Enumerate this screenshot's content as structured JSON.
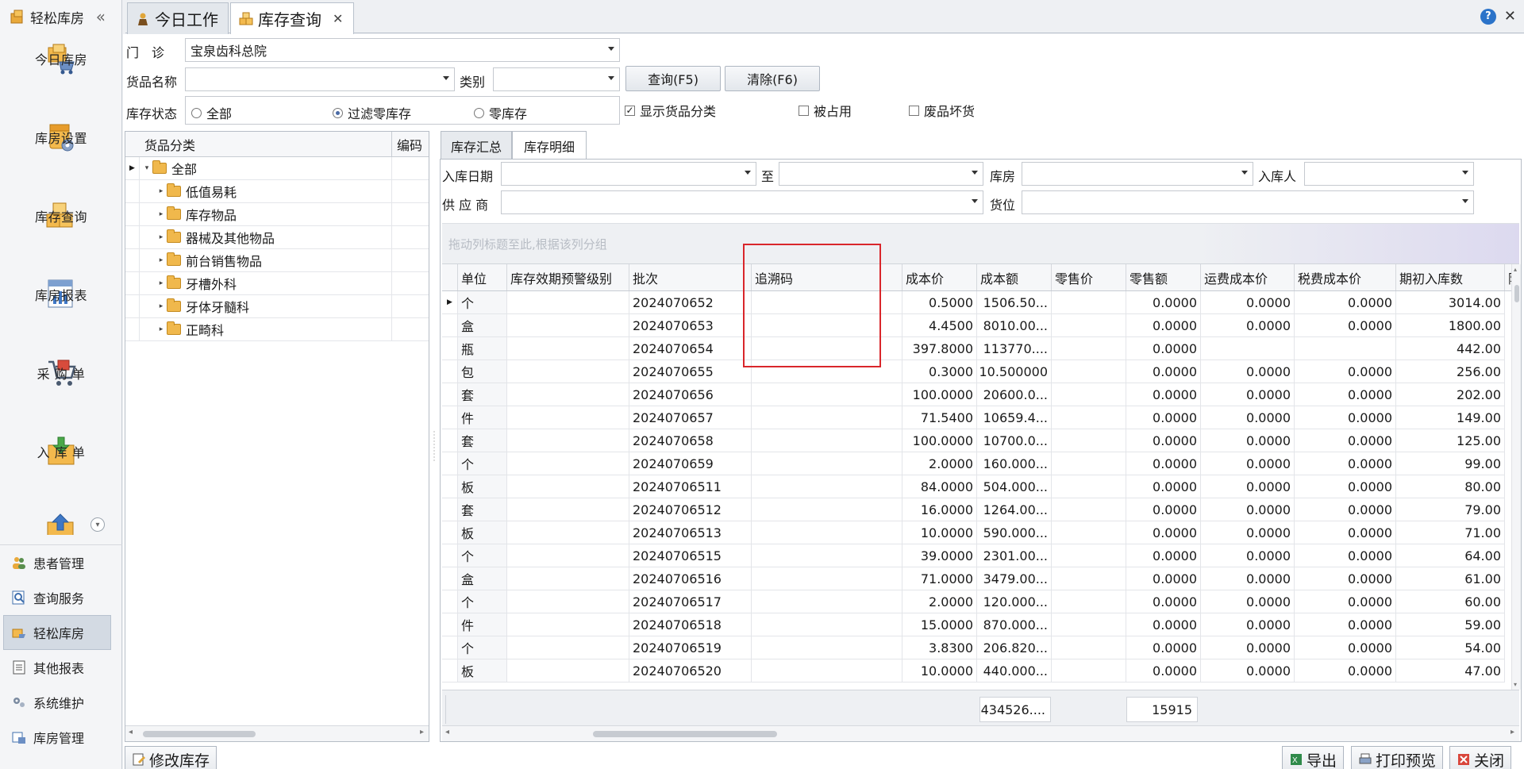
{
  "app": {
    "name": "轻松库房",
    "collapse": "«"
  },
  "nav": {
    "big_items": [
      "今日库房",
      "库房设置",
      "库存查询",
      "库房报表",
      "采 购 单",
      "入 库 单"
    ],
    "small_items": [
      "患者管理",
      "查询服务",
      "轻松库房",
      "其他报表",
      "系统维护",
      "库房管理"
    ],
    "active_small": "轻松库房"
  },
  "tabs": {
    "tab1": "今日工作",
    "tab2": "库存查询",
    "close": "✕"
  },
  "filters": {
    "clinic_label": "门　诊",
    "clinic_value": "宝泉齿科总院",
    "goods_label": "货品名称",
    "goods_value": "",
    "category_label": "类别",
    "category_value": "",
    "query_btn": "查询(F5)",
    "clear_btn": "清除(F6)",
    "status_label": "库存状态",
    "status_opts": [
      "全部",
      "过滤零库存",
      "零库存"
    ],
    "status_selected": "过滤零库存",
    "show_category": "显示货品分类",
    "occupied": "被占用",
    "waste": "废品坏货"
  },
  "tree": {
    "col_category": "货品分类",
    "col_code": "编码",
    "root": "全部",
    "children": [
      "低值易耗",
      "库存物品",
      "器械及其他物品",
      "前台销售物品",
      "牙槽外科",
      "牙体牙髓科",
      "正畸科"
    ]
  },
  "subtabs": {
    "summary": "库存汇总",
    "detail": "库存明细"
  },
  "detail_filters": {
    "in_date": "入库日期",
    "to": "至",
    "warehouse": "库房",
    "in_person": "入库人",
    "supplier": "供 应 商",
    "location": "货位"
  },
  "group_hint": "拖动列标题至此,根据该列分组",
  "grid": {
    "columns": [
      "单位",
      "库存效期预警级别",
      "批次",
      "追溯码",
      "成本价",
      "成本额",
      "零售价",
      "零售额",
      "运费成本价",
      "税费成本价",
      "期初入库数",
      "附"
    ],
    "rows": [
      [
        "个",
        "",
        "2024070652",
        "",
        "0.5000",
        "1506.50...",
        "",
        "0.0000",
        "0.0000",
        "0.0000",
        "3014.00"
      ],
      [
        "盒",
        "",
        "2024070653",
        "",
        "4.4500",
        "8010.00...",
        "",
        "0.0000",
        "0.0000",
        "0.0000",
        "1800.00"
      ],
      [
        "瓶",
        "",
        "2024070654",
        "",
        "397.8000",
        "113770....",
        "",
        "0.0000",
        "",
        "",
        "442.00"
      ],
      [
        "包",
        "",
        "2024070655",
        "",
        "0.3000",
        "10.500000",
        "",
        "0.0000",
        "0.0000",
        "0.0000",
        "256.00"
      ],
      [
        "套",
        "",
        "2024070656",
        "",
        "100.0000",
        "20600.0...",
        "",
        "0.0000",
        "0.0000",
        "0.0000",
        "202.00"
      ],
      [
        "件",
        "",
        "2024070657",
        "",
        "71.5400",
        "10659.4...",
        "",
        "0.0000",
        "0.0000",
        "0.0000",
        "149.00"
      ],
      [
        "套",
        "",
        "2024070658",
        "",
        "100.0000",
        "10700.0...",
        "",
        "0.0000",
        "0.0000",
        "0.0000",
        "125.00"
      ],
      [
        "个",
        "",
        "2024070659",
        "",
        "2.0000",
        "160.000...",
        "",
        "0.0000",
        "0.0000",
        "0.0000",
        "99.00"
      ],
      [
        "板",
        "",
        "20240706511",
        "",
        "84.0000",
        "504.000...",
        "",
        "0.0000",
        "0.0000",
        "0.0000",
        "80.00"
      ],
      [
        "套",
        "",
        "20240706512",
        "",
        "16.0000",
        "1264.00...",
        "",
        "0.0000",
        "0.0000",
        "0.0000",
        "79.00"
      ],
      [
        "板",
        "",
        "20240706513",
        "",
        "10.0000",
        "590.000...",
        "",
        "0.0000",
        "0.0000",
        "0.0000",
        "71.00"
      ],
      [
        "个",
        "",
        "20240706515",
        "",
        "39.0000",
        "2301.00...",
        "",
        "0.0000",
        "0.0000",
        "0.0000",
        "64.00"
      ],
      [
        "盒",
        "",
        "20240706516",
        "",
        "71.0000",
        "3479.00...",
        "",
        "0.0000",
        "0.0000",
        "0.0000",
        "61.00"
      ],
      [
        "个",
        "",
        "20240706517",
        "",
        "2.0000",
        "120.000...",
        "",
        "0.0000",
        "0.0000",
        "0.0000",
        "60.00"
      ],
      [
        "件",
        "",
        "20240706518",
        "",
        "15.0000",
        "870.000...",
        "",
        "0.0000",
        "0.0000",
        "0.0000",
        "59.00"
      ],
      [
        "个",
        "",
        "20240706519",
        "",
        "3.8300",
        "206.820...",
        "",
        "0.0000",
        "0.0000",
        "0.0000",
        "54.00"
      ],
      [
        "板",
        "",
        "20240706520",
        "",
        "10.0000",
        "440.000...",
        "",
        "0.0000",
        "0.0000",
        "0.0000",
        "47.00"
      ]
    ],
    "total_cost": "434526....",
    "total_retail": "15915"
  },
  "bottom": {
    "modify": "修改库存",
    "export": "导出",
    "print": "打印预览",
    "close": "关闭"
  },
  "colors": {
    "accent": "#2b73c9",
    "highlight": "#d9262b",
    "folder": "#f0b84c"
  },
  "icons": [
    "home-icon",
    "gear-box-icon",
    "boxes-icon",
    "report-icon",
    "cart-icon",
    "inbox-icon",
    "help-icon"
  ]
}
